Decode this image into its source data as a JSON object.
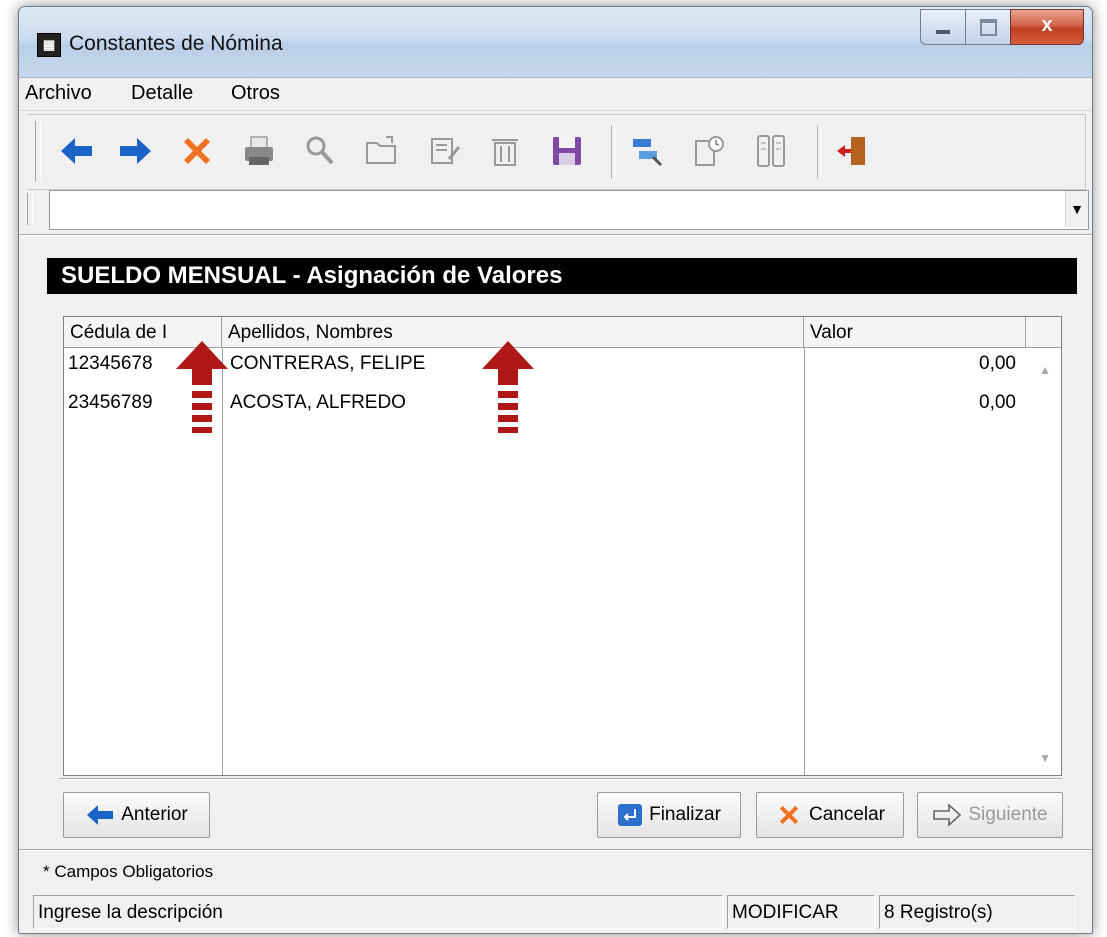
{
  "window": {
    "title": "Constantes de Nómina",
    "close_glyph": "x"
  },
  "menu": {
    "items": [
      "Archivo",
      "Detalle",
      "Otros"
    ]
  },
  "toolbar": {
    "icons": [
      "back-arrow-icon",
      "forward-arrow-icon",
      "delete-x-icon",
      "printer-icon",
      "search-icon",
      "open-folder-icon",
      "edit-document-icon",
      "trash-icon",
      "save-disk-icon",
      "transfer-icon",
      "document-clock-icon",
      "columns-icon",
      "exit-door-icon"
    ]
  },
  "combo": {
    "value": ""
  },
  "banner": {
    "text": "SUELDO MENSUAL - Asignación de Valores"
  },
  "grid": {
    "columns": [
      "Cédula de I",
      "Apellidos, Nombres",
      "Valor"
    ],
    "rows": [
      {
        "cedula": "12345678",
        "nombre": "CONTRERAS, FELIPE",
        "valor": "0,00"
      },
      {
        "cedula": "23456789",
        "nombre": "ACOSTA, ALFREDO",
        "valor": "0,00"
      }
    ]
  },
  "buttons": {
    "anterior": "Anterior",
    "finalizar": "Finalizar",
    "cancelar": "Cancelar",
    "siguiente": "Siguiente"
  },
  "footnote": "* Campos Obligatorios",
  "status": {
    "hint": "Ingrese la descripción",
    "mode": "MODIFICAR",
    "records": "8 Registro(s)"
  },
  "colors": {
    "banner_bg": "#000000",
    "arrow_red": "#b01818",
    "toolbar_blue": "#1a63c8"
  }
}
